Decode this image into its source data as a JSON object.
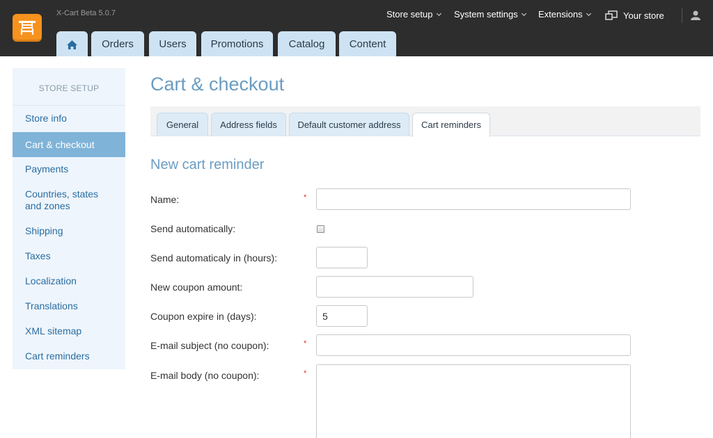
{
  "app": {
    "version": "X-Cart Beta 5.0.7"
  },
  "topnav": {
    "store_setup": "Store setup",
    "system_settings": "System settings",
    "extensions": "Extensions",
    "your_store": "Your store"
  },
  "main_tabs": [
    "Orders",
    "Users",
    "Promotions",
    "Catalog",
    "Content"
  ],
  "sidebar": {
    "heading": "STORE SETUP",
    "items": [
      "Store info",
      "Cart & checkout",
      "Payments",
      "Countries, states and zones",
      "Shipping",
      "Taxes",
      "Localization",
      "Translations",
      "XML sitemap",
      "Cart reminders"
    ],
    "active_index": 1
  },
  "page": {
    "title": "Cart & checkout",
    "tabs": [
      "General",
      "Address fields",
      "Default customer address",
      "Cart reminders"
    ],
    "active_tab": "Cart reminders",
    "section_title": "New cart reminder"
  },
  "form": {
    "name": {
      "label": "Name:",
      "value": "",
      "required": "*"
    },
    "send_automatically": {
      "label": "Send automatically:",
      "checked": false
    },
    "send_in_hours": {
      "label": "Send automaticaly in (hours):",
      "value": ""
    },
    "coupon_amount": {
      "label": "New coupon amount:",
      "value": ""
    },
    "coupon_expire": {
      "label": "Coupon expire in (days):",
      "value": "5"
    },
    "email_subject": {
      "label": "E-mail subject (no coupon):",
      "value": "",
      "required": "*"
    },
    "email_body": {
      "label": "E-mail body (no coupon):",
      "value": "",
      "required": "*"
    }
  },
  "colors": {
    "topbar": "#2d2d2d",
    "logo": "#f7921e",
    "tab": "#cde3f4",
    "sidebar_bg": "#eef5fc",
    "sidebar_active": "#7fb3d8",
    "link": "#2a6da0",
    "heading": "#6a9dc2",
    "required": "#e03030"
  },
  "icons": {
    "logo": "cart-logo-icon",
    "home": "home-icon",
    "your_store": "store-window-icon",
    "user": "user-icon"
  }
}
